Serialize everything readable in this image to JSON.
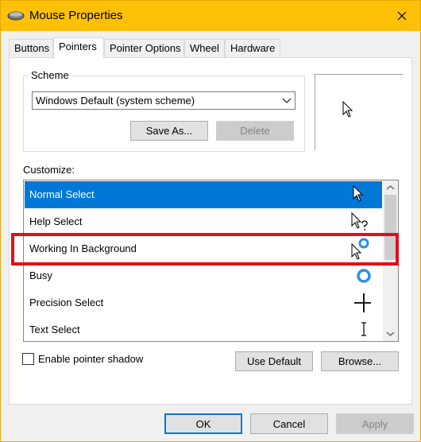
{
  "window": {
    "title": "Mouse Properties",
    "title_icon": "mouse-icon",
    "close_icon": "close-icon"
  },
  "tabs": [
    {
      "label": "Buttons",
      "active": false
    },
    {
      "label": "Pointers",
      "active": true
    },
    {
      "label": "Pointer Options",
      "active": false
    },
    {
      "label": "Wheel",
      "active": false
    },
    {
      "label": "Hardware",
      "active": false
    }
  ],
  "scheme": {
    "label": "Scheme",
    "selected": "Windows Default (system scheme)",
    "save_as": "Save As...",
    "delete": "Delete"
  },
  "customize": {
    "label": "Customize:",
    "items": [
      {
        "label": "Normal Select",
        "icon": "arrow-cursor-icon",
        "selected": true
      },
      {
        "label": "Help Select",
        "icon": "help-cursor-icon",
        "selected": false
      },
      {
        "label": "Working In Background",
        "icon": "working-cursor-icon",
        "selected": false
      },
      {
        "label": "Busy",
        "icon": "busy-cursor-icon",
        "selected": false
      },
      {
        "label": "Precision Select",
        "icon": "crosshair-cursor-icon",
        "selected": false
      },
      {
        "label": "Text Select",
        "icon": "text-cursor-icon",
        "selected": false
      }
    ]
  },
  "options": {
    "enable_shadow": "Enable pointer shadow",
    "use_default": "Use Default",
    "browse": "Browse..."
  },
  "footer": {
    "ok": "OK",
    "cancel": "Cancel",
    "apply": "Apply"
  },
  "colors": {
    "titlebar": "#ffc107",
    "selection": "#0078d7",
    "highlight": "#e0101a",
    "busy_ring": "#2b8fe8"
  }
}
